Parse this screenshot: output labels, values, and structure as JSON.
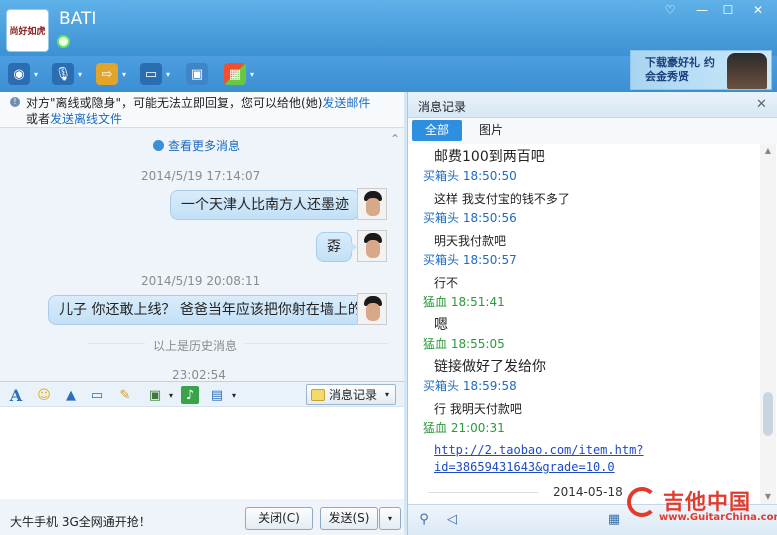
{
  "window": {
    "contact_name": "BATI",
    "logo_text": "尚好如虎",
    "controls": {
      "skin": "♡",
      "minimize": "—",
      "maximize": "☐",
      "close": "✕"
    }
  },
  "toolbar": {
    "items": [
      {
        "icon": "video-call-icon",
        "glyph": "◉"
      },
      {
        "icon": "microphone-icon",
        "glyph": "🎙"
      },
      {
        "icon": "file-transfer-icon",
        "glyph": "⇨"
      },
      {
        "icon": "remote-desktop-icon",
        "glyph": "▭"
      },
      {
        "icon": "screen-share-icon",
        "glyph": "▣"
      },
      {
        "icon": "apps-icon",
        "glyph": "▦"
      }
    ],
    "caret": "▾",
    "ad_text": "下载豪好礼 约会金秀贤"
  },
  "notice": {
    "line1_prefix": "对方\"离线或隐身\"，可能无法立即回复，您可以给他(她)",
    "line1_link": "发送邮件",
    "line2_prefix": "或者",
    "line2_link": "发送离线文件",
    "close": "✕"
  },
  "chat": {
    "more_messages": "查看更多消息",
    "messages": [
      {
        "time": "2014/5/19 17:14:07",
        "text": "一个天津人比南方人还墨迹"
      },
      {
        "time": "",
        "text": "孬"
      },
      {
        "time": "2014/5/19 20:08:11",
        "text": "儿子 你还敢上线？ 爸爸当年应该把你射在墙上的"
      }
    ],
    "history_divider": "以上是历史消息",
    "partial_time": "23:02:54"
  },
  "input_toolbar": {
    "font_icon": "A",
    "record_label": "消息记录",
    "record_caret": "▾"
  },
  "bottom": {
    "promo": "大牛手机 3G全网通开抢！",
    "close_label": "关闭(C)",
    "send_label": "发送(S)",
    "send_caret": "▾"
  },
  "history_panel": {
    "title": "消息记录",
    "close": "✕",
    "tabs": [
      {
        "label": "全部",
        "active": true
      },
      {
        "label": "图片",
        "active": false
      }
    ],
    "entries": [
      {
        "type": "msg",
        "text": "邮费100到两百吧",
        "size": "large"
      },
      {
        "type": "sender",
        "name": "买箱头",
        "time": "18:50:50",
        "color": "#1e6ac2"
      },
      {
        "type": "msg",
        "text": "这样 我支付宝的钱不多了",
        "size": "small"
      },
      {
        "type": "sender",
        "name": "买箱头",
        "time": "18:50:56",
        "color": "#1e6ac2"
      },
      {
        "type": "msg",
        "text": "明天我付款吧",
        "size": "small"
      },
      {
        "type": "sender",
        "name": "买箱头",
        "time": "18:50:57",
        "color": "#1e6ac2"
      },
      {
        "type": "msg",
        "text": "行不",
        "size": "small"
      },
      {
        "type": "sender",
        "name": "猛血",
        "time": "18:51:41",
        "color": "#2a9a3a"
      },
      {
        "type": "msg",
        "text": "嗯",
        "size": "large"
      },
      {
        "type": "sender",
        "name": "猛血",
        "time": "18:55:05",
        "color": "#2a9a3a"
      },
      {
        "type": "msg",
        "text": "链接做好了发给你",
        "size": "large"
      },
      {
        "type": "sender",
        "name": "买箱头",
        "time": "18:59:58",
        "color": "#1e6ac2"
      },
      {
        "type": "msg",
        "text": "行 我明天付款吧",
        "size": "small"
      },
      {
        "type": "sender",
        "name": "猛血",
        "time": "21:00:31",
        "color": "#2a9a3a"
      }
    ],
    "link_text": "http://2.taobao.com/item.htm?id=38659431643&grade=10.0",
    "date_separator": "2014-05-18"
  },
  "watermark": {
    "big": "吉他中国",
    "small": "www.GuitarChina.com"
  }
}
